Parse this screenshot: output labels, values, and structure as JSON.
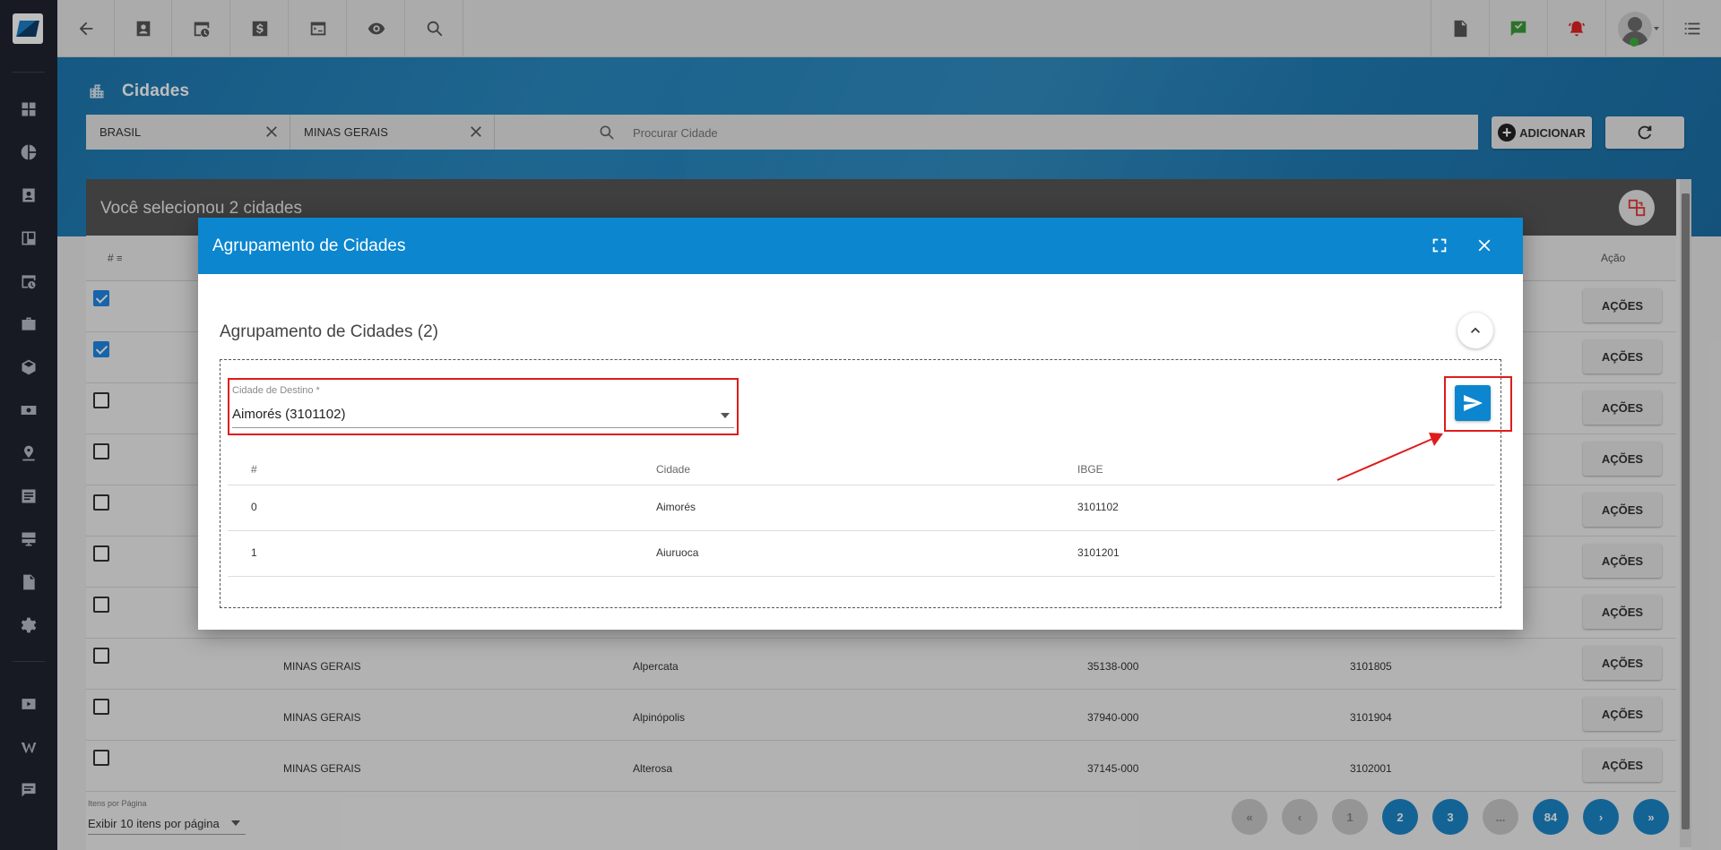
{
  "page": {
    "title": "Cidades"
  },
  "filters": {
    "country": "BRASIL",
    "state": "MINAS GERAIS",
    "search_placeholder": "Procurar Cidade"
  },
  "buttons": {
    "add_label": "ADICIONAR"
  },
  "selection": {
    "text": "Você selecionou 2 cidades"
  },
  "table": {
    "header_num": "#",
    "header_action": "Ação",
    "rows": [
      {
        "checked": true,
        "uf": "",
        "city": "",
        "cep": "",
        "ibge": "",
        "action": "AÇÕES"
      },
      {
        "checked": true,
        "uf": "",
        "city": "",
        "cep": "",
        "ibge": "",
        "action": "AÇÕES"
      },
      {
        "checked": false,
        "uf": "",
        "city": "",
        "cep": "",
        "ibge": "",
        "action": "AÇÕES"
      },
      {
        "checked": false,
        "uf": "",
        "city": "",
        "cep": "",
        "ibge": "",
        "action": "AÇÕES"
      },
      {
        "checked": false,
        "uf": "",
        "city": "",
        "cep": "",
        "ibge": "",
        "action": "AÇÕES"
      },
      {
        "checked": false,
        "uf": "",
        "city": "",
        "cep": "",
        "ibge": "",
        "action": "AÇÕES"
      },
      {
        "checked": false,
        "uf": "",
        "city": "",
        "cep": "",
        "ibge": "",
        "action": "AÇÕES"
      },
      {
        "checked": false,
        "uf": "MINAS GERAIS",
        "city": "Alpercata",
        "cep": "35138-000",
        "ibge": "3101805",
        "action": "AÇÕES"
      },
      {
        "checked": false,
        "uf": "MINAS GERAIS",
        "city": "Alpinópolis",
        "cep": "37940-000",
        "ibge": "3101904",
        "action": "AÇÕES"
      },
      {
        "checked": false,
        "uf": "MINAS GERAIS",
        "city": "Alterosa",
        "cep": "37145-000",
        "ibge": "3102001",
        "action": "AÇÕES"
      }
    ]
  },
  "pagination": {
    "per_page_label": "Itens por Página",
    "per_page_value": "Exibir 10 itens por página",
    "first": "«",
    "prev": "‹",
    "pages": [
      "1",
      "2",
      "3",
      "...",
      "84"
    ],
    "next": "›",
    "last": "»"
  },
  "modal": {
    "title": "Agrupamento de Cidades",
    "section_title": "Agrupamento de Cidades (2)",
    "select_label": "Cidade de Destino *",
    "select_value": "Aimorés (3101102)",
    "table_headers": [
      "#",
      "Cidade",
      "IBGE"
    ],
    "rows": [
      {
        "n": "0",
        "city": "Aimorés",
        "ibge": "3101102"
      },
      {
        "n": "1",
        "city": "Aiuruoca",
        "ibge": "3101201"
      }
    ]
  },
  "colors": {
    "primary": "#0b86cf",
    "highlight": "#e01b1b",
    "sidebar": "#1f2430"
  }
}
